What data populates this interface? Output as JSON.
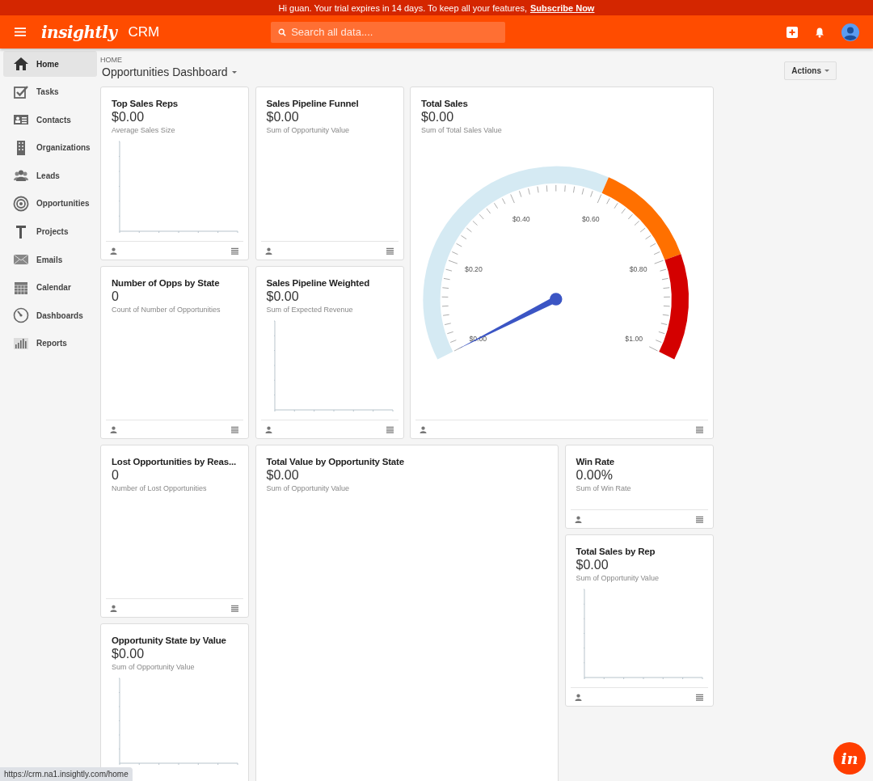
{
  "banner": {
    "text": "Hi guan. Your trial expires in 14 days. To keep all your features,",
    "link": "Subscribe Now"
  },
  "header": {
    "logo": "insightly",
    "app": "CRM",
    "search": {
      "placeholder": "Search all data...."
    }
  },
  "sidebar": {
    "items": [
      {
        "label": "Home",
        "selected": true
      },
      {
        "label": "Tasks",
        "selected": false
      },
      {
        "label": "Contacts",
        "selected": false
      },
      {
        "label": "Organizations",
        "selected": false
      },
      {
        "label": "Leads",
        "selected": false
      },
      {
        "label": "Opportunities",
        "selected": false
      },
      {
        "label": "Projects",
        "selected": false
      },
      {
        "label": "Emails",
        "selected": false
      },
      {
        "label": "Calendar",
        "selected": false
      },
      {
        "label": "Dashboards",
        "selected": false
      },
      {
        "label": "Reports",
        "selected": false
      }
    ]
  },
  "breadcrumb": "HOME",
  "page_title": "Opportunities Dashboard",
  "actions_button": "Actions",
  "cards": [
    {
      "title": "Top Sales Reps",
      "value": "$0.00",
      "subtitle": "Average Sales Size",
      "kind": "axes"
    },
    {
      "title": "Sales Pipeline Funnel",
      "value": "$0.00",
      "subtitle": "Sum of Opportunity Value",
      "kind": "blank"
    },
    {
      "title": "Total Sales",
      "value": "$0.00",
      "subtitle": "Sum of Total Sales Value",
      "kind": "gauge",
      "gauge": {
        "labels": [
          "$0.00",
          "$0.20",
          "$0.40",
          "$0.60",
          "$0.80",
          "$1.00"
        ]
      }
    },
    {
      "title": "Number of Opps by State",
      "value": "0",
      "subtitle": "Count of Number of Opportunities",
      "kind": "blank"
    },
    {
      "title": "Sales Pipeline Weighted",
      "value": "$0.00",
      "subtitle": "Sum of Expected Revenue",
      "kind": "axes"
    },
    {
      "title": "Lost Opportunities by Reas...",
      "value": "0",
      "subtitle": "Number of Lost Opportunities",
      "kind": "blank"
    },
    {
      "title": "Total Value by Opportunity State",
      "value": "$0.00",
      "subtitle": "Sum of Opportunity Value",
      "kind": "blank"
    },
    {
      "title": "Win Rate",
      "value": "0.00%",
      "subtitle": "Sum of Win Rate",
      "kind": "blank"
    },
    {
      "title": "Total Sales by Rep",
      "value": "$0.00",
      "subtitle": "Sum of Opportunity Value",
      "kind": "axes"
    },
    {
      "title": "Opportunity State by Value",
      "value": "$0.00",
      "subtitle": "Sum of Opportunity Value",
      "kind": "axes"
    }
  ],
  "status_url": "https://crm.na1.insightly.com/home",
  "floating_button": "in"
}
